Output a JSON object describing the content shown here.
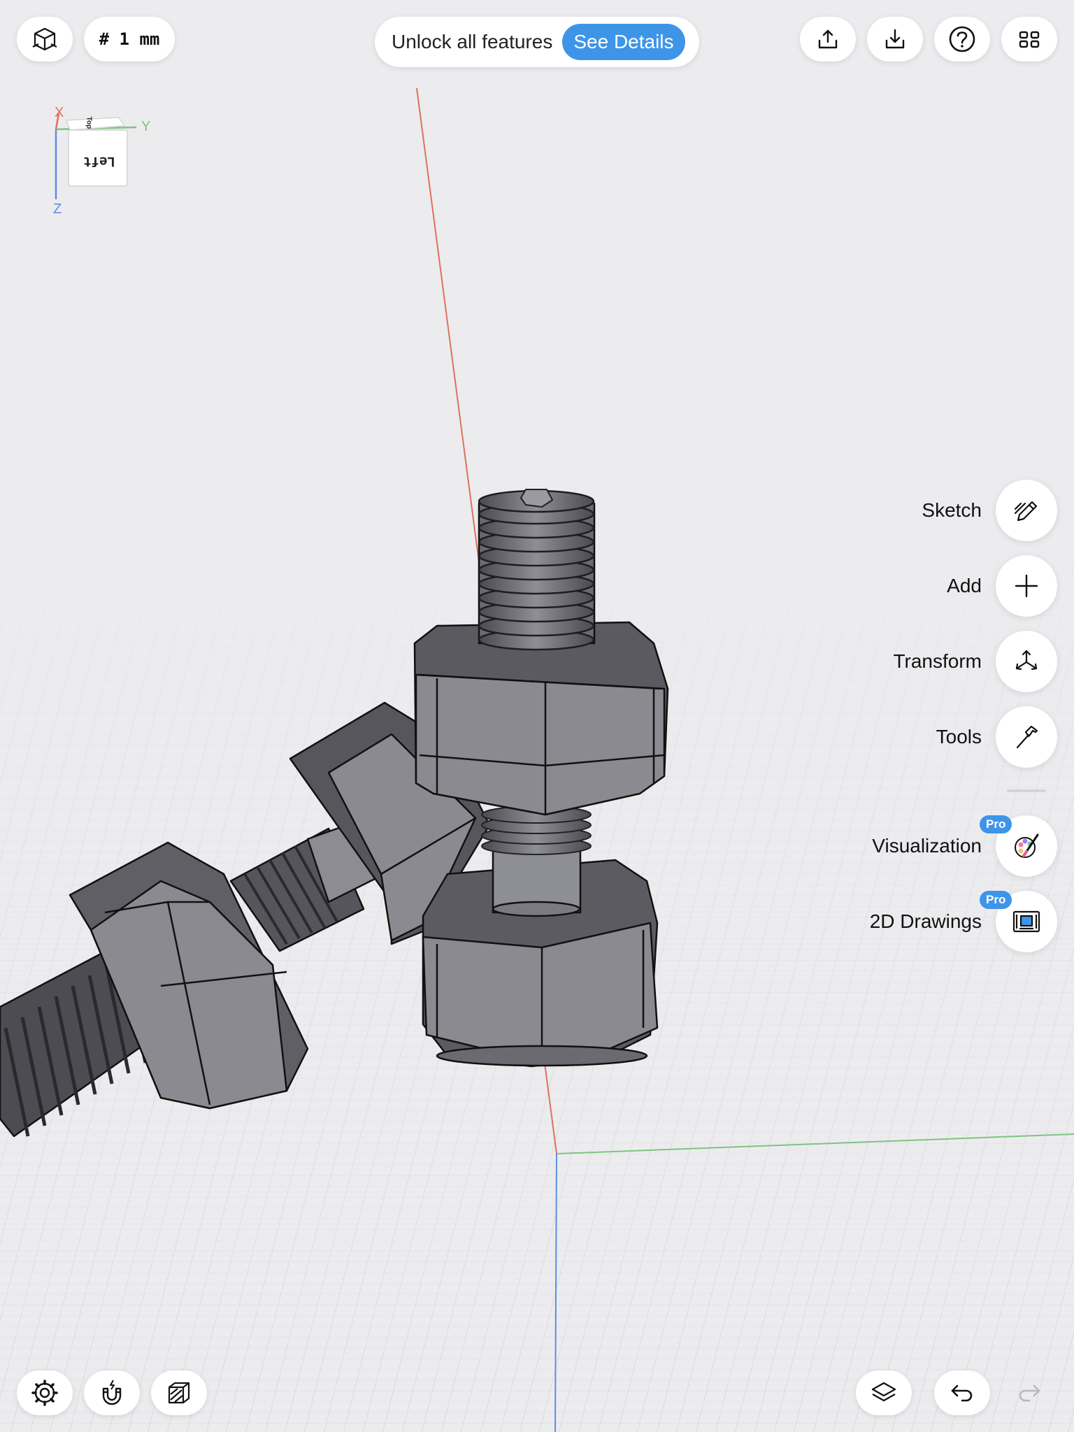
{
  "toolbar": {
    "grid_label": "# 1 mm",
    "banner_text": "Unlock all features",
    "banner_button": "See Details"
  },
  "view_cube": {
    "face_label": "Left",
    "top_label": "Top",
    "axis_x": "X",
    "axis_y": "Y",
    "axis_z": "Z"
  },
  "side_tools": {
    "sketch": "Sketch",
    "add": "Add",
    "transform": "Transform",
    "tools": "Tools",
    "visualization": "Visualization",
    "drawings_2d": "2D Drawings",
    "pro_badge": "Pro"
  },
  "icons": {
    "view-mode": "cube-outline-icon",
    "share": "share-upload-icon",
    "download": "download-icon",
    "help": "question-circle-icon",
    "grid": "grid-four-icon",
    "sketch": "pencil-sketch-icon",
    "add": "plus-icon",
    "transform": "transform-arrows-icon",
    "tools": "hammer-icon",
    "visualization": "palette-brush-icon",
    "drawings": "blueprint-icon",
    "settings": "gear-icon",
    "snap": "magnet-icon",
    "section": "section-plane-icon",
    "layers": "layers-icon",
    "undo": "undo-icon",
    "redo": "redo-icon"
  },
  "colors": {
    "accent": "#3e95e8",
    "axis_x": "#e0705e",
    "axis_y": "#7fc47f",
    "axis_z": "#5b8fe0",
    "background": "#ececef",
    "part_fill": "#8a8a90",
    "part_dark": "#5a5a60"
  }
}
